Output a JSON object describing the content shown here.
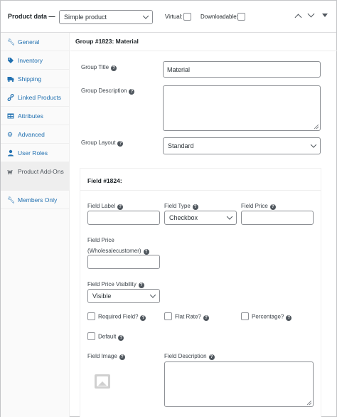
{
  "header": {
    "title": "Product data —",
    "product_type": "Simple product",
    "virtual_label": "Virtual:",
    "downloadable_label": "Downloadable:"
  },
  "sidebar": {
    "items": [
      {
        "label": "General",
        "icon": "wrench-icon"
      },
      {
        "label": "Inventory",
        "icon": "tag-icon"
      },
      {
        "label": "Shipping",
        "icon": "truck-icon"
      },
      {
        "label": "Linked Products",
        "icon": "link-icon"
      },
      {
        "label": "Attributes",
        "icon": "table-icon"
      },
      {
        "label": "Advanced",
        "icon": "gear-icon"
      },
      {
        "label": "User Roles",
        "icon": "user-icon"
      },
      {
        "label": "Product Add-Ons",
        "icon": "woo-icon"
      },
      {
        "label": "Members Only",
        "icon": "wrench-icon"
      }
    ]
  },
  "group": {
    "heading": "Group #1823: Material",
    "title_label": "Group Title",
    "title_value": "Material",
    "description_label": "Group Description",
    "layout_label": "Group Layout",
    "layout_value": "Standard"
  },
  "field": {
    "heading": "Field #1824:",
    "label_label": "Field Label",
    "type_label": "Field Type",
    "type_value": "Checkbox",
    "price_label": "Field Price",
    "wholesale_label_1": "Field Price",
    "wholesale_label_2": "(Wholesalecustomer)",
    "visibility_label": "Field Price Visibility",
    "visibility_value": "Visible",
    "required_label": "Required Field?",
    "flat_rate_label": "Flat Rate?",
    "percentage_label": "Percentage?",
    "default_label": "Default",
    "image_label": "Field Image",
    "description_label": "Field Description"
  },
  "colors": {
    "link": "#2271b1",
    "border": "#8c8f94"
  }
}
